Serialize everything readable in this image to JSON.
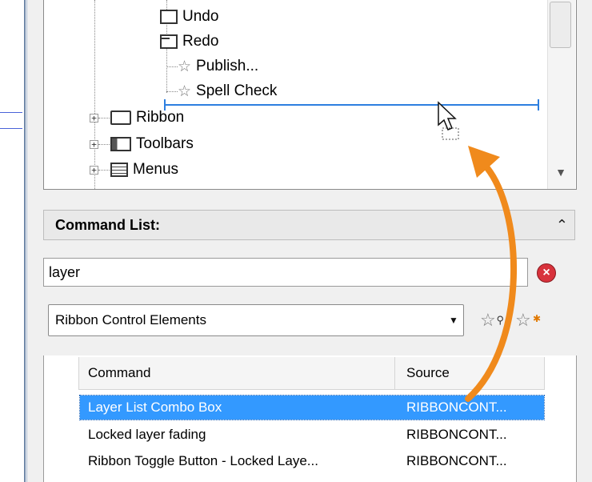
{
  "tree": {
    "items": [
      {
        "label": "Undo"
      },
      {
        "label": "Redo"
      },
      {
        "label": "Publish..."
      },
      {
        "label": "Spell Check"
      }
    ],
    "categories": [
      {
        "label": "Ribbon"
      },
      {
        "label": "Toolbars"
      },
      {
        "label": "Menus"
      }
    ]
  },
  "command_list": {
    "title": "Command List:",
    "search_value": "layer",
    "filter_value": "Ribbon Control Elements",
    "columns": [
      "Command",
      "Source"
    ],
    "rows": [
      {
        "command": "Layer List Combo Box",
        "source": "RIBBONCONT...",
        "selected": true
      },
      {
        "command": "Locked layer fading",
        "source": "RIBBONCONT...",
        "selected": false
      },
      {
        "command": "Ribbon Toggle Button - Locked Laye...",
        "source": "RIBBONCONT...",
        "selected": false
      }
    ]
  },
  "colors": {
    "selection": "#3399ff",
    "drop_indicator": "#2d7fe0",
    "callout_arrow": "#f08a1c"
  },
  "icons": {
    "tree_item": "star-icon",
    "category": "folder-icon",
    "clear": "clear-search-icon",
    "find_star": "star-search-icon",
    "new_star": "star-new-icon"
  }
}
